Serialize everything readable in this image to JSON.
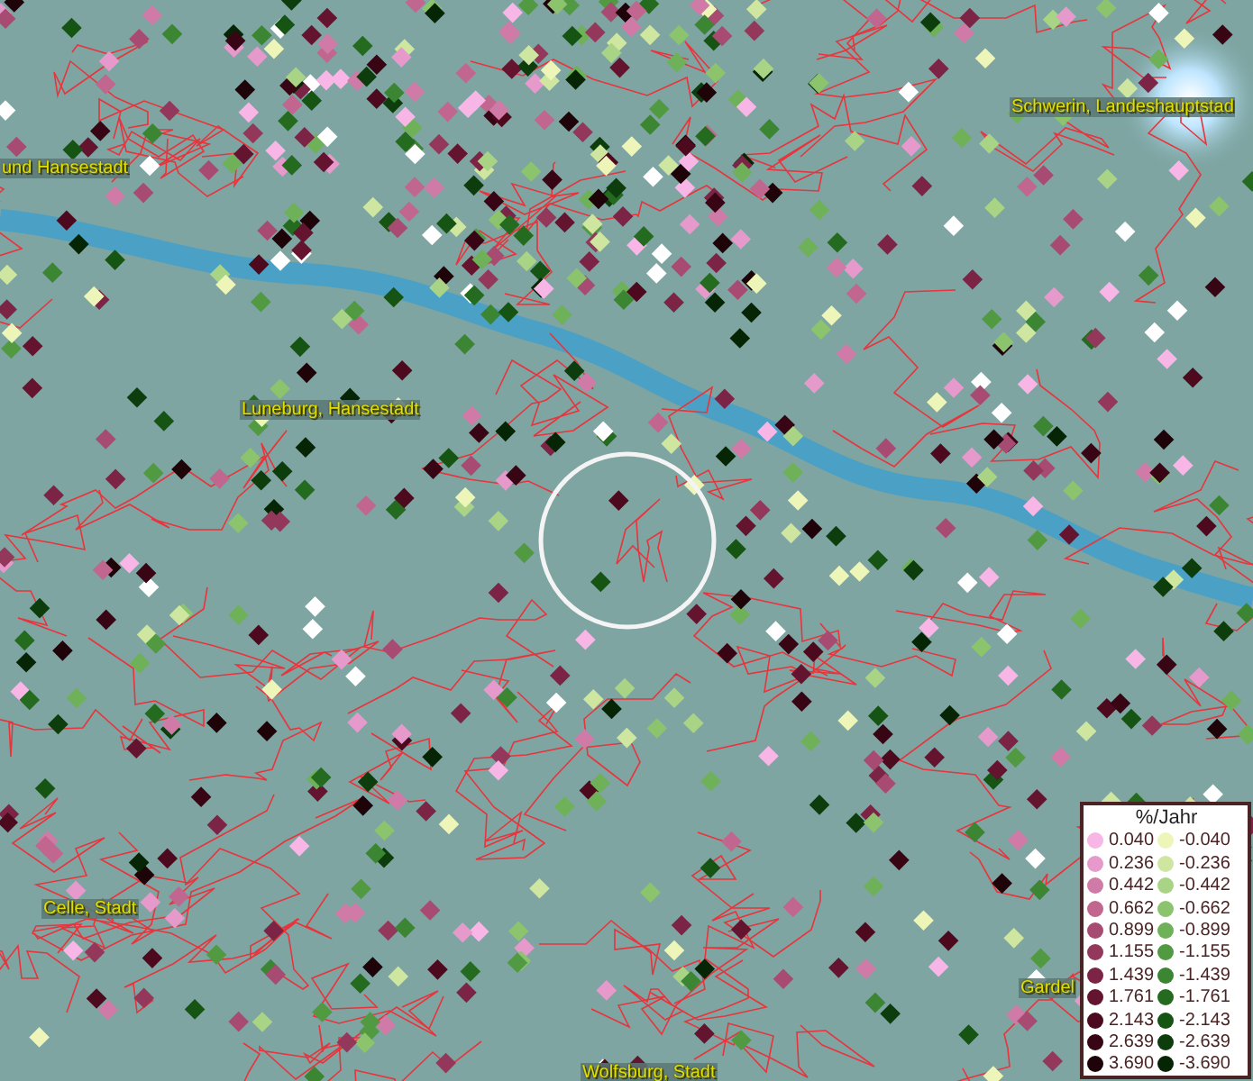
{
  "map_labels": [
    {
      "text": "und Hansestadt"
    },
    {
      "text": "Schwerin, Landeshauptstad"
    },
    {
      "text": "Luneburg, Hansestadt"
    },
    {
      "text": "Celle, Stadt"
    },
    {
      "text": "Gardel"
    },
    {
      "text": "Wolfsburg, Stadt"
    }
  ],
  "legend": {
    "title": "%/Jahr",
    "positive": [
      {
        "value": "0.040",
        "color": "#f7b6e6"
      },
      {
        "value": "0.236",
        "color": "#e59acb"
      },
      {
        "value": "0.442",
        "color": "#d07aa8"
      },
      {
        "value": "0.662",
        "color": "#c0668f"
      },
      {
        "value": "0.899",
        "color": "#a84b72"
      },
      {
        "value": "1.155",
        "color": "#93385a"
      },
      {
        "value": "1.439",
        "color": "#7c2446"
      },
      {
        "value": "1.761",
        "color": "#651430"
      },
      {
        "value": "2.143",
        "color": "#4d0a1e"
      },
      {
        "value": "2.639",
        "color": "#370514"
      },
      {
        "value": "3.690",
        "color": "#1e0308"
      }
    ],
    "negative": [
      {
        "value": "-0.040",
        "color": "#eef5b8"
      },
      {
        "value": "-0.236",
        "color": "#cfe6a0"
      },
      {
        "value": "-0.442",
        "color": "#a9d486"
      },
      {
        "value": "-0.662",
        "color": "#8cc46e"
      },
      {
        "value": "-0.899",
        "color": "#6fb158"
      },
      {
        "value": "-1.155",
        "color": "#519a42"
      },
      {
        "value": "-1.439",
        "color": "#3b8533"
      },
      {
        "value": "-1.761",
        "color": "#246b20"
      },
      {
        "value": "-2.143",
        "color": "#165414"
      },
      {
        "value": "-2.639",
        "color": "#0d3d0c"
      },
      {
        "value": "-3.690",
        "color": "#052505"
      }
    ]
  }
}
